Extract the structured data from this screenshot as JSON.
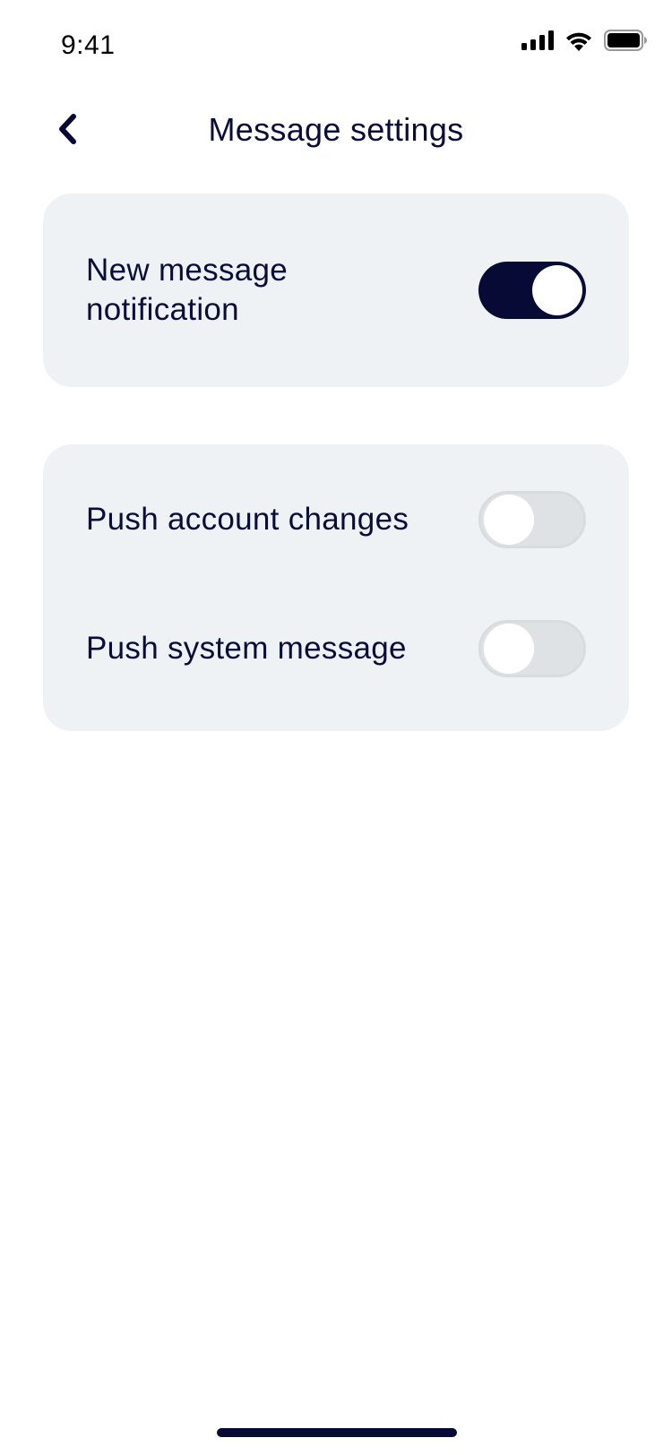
{
  "status_bar": {
    "time": "9:41",
    "icons": [
      "signal-icon",
      "wifi-icon",
      "battery-icon"
    ]
  },
  "nav": {
    "back_icon": "chevron-left-icon",
    "title": "Message settings"
  },
  "settings": {
    "group1": [
      {
        "label": "New message\nnotification",
        "enabled": true
      }
    ],
    "group2": [
      {
        "label": "Push account changes",
        "enabled": false
      },
      {
        "label": "Push system message",
        "enabled": false
      }
    ]
  },
  "colors": {
    "primary": "#070a35",
    "card_background": "#eef2f5",
    "toggle_off": "#dfe2e5"
  }
}
